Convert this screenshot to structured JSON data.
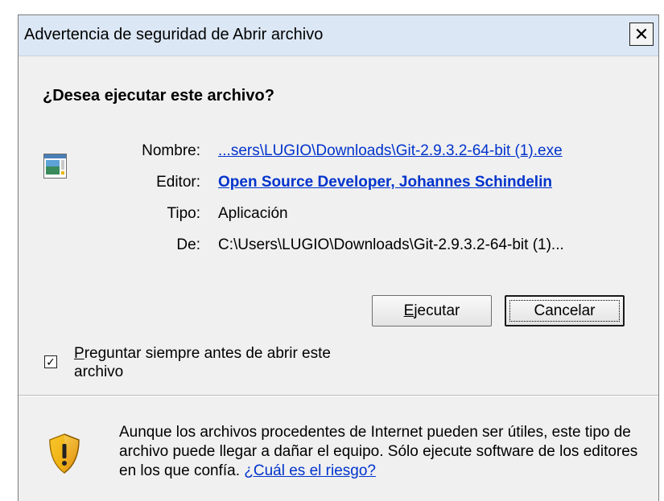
{
  "window": {
    "title": "Advertencia de seguridad de Abrir archivo",
    "close_label": "✕"
  },
  "prompt": {
    "question": "¿Desea ejecutar este archivo?"
  },
  "file_info": {
    "name_label": "Nombre:",
    "name_value": "...sers\\LUGIO\\Downloads\\Git-2.9.3.2-64-bit (1).exe",
    "publisher_label": "Editor:",
    "publisher_value": "Open Source Developer, Johannes Schindelin",
    "type_label": "Tipo:",
    "type_value": "Aplicación",
    "from_label": "De:",
    "from_value": "C:\\Users\\LUGIO\\Downloads\\Git-2.9.3.2-64-bit (1)..."
  },
  "buttons": {
    "run_label": "Ejecutar",
    "cancel_label": "Cancelar"
  },
  "checkbox": {
    "label_line": "Preguntar siempre antes de abrir este archivo",
    "checked": true
  },
  "warning": {
    "text": "Aunque los archivos procedentes de Internet pueden ser útiles, este tipo de archivo puede llegar a dañar el equipo. Sólo ejecute software de los editores en los que confía.",
    "risk_link": "¿Cuál es el riesgo?"
  },
  "colors": {
    "link": "#0033cc",
    "titlebar": "#dce7f5",
    "dialog_bg": "#f0f0f0"
  },
  "icons": [
    "application-file-icon",
    "security-shield-icon",
    "close-icon",
    "checkmark-icon"
  ]
}
